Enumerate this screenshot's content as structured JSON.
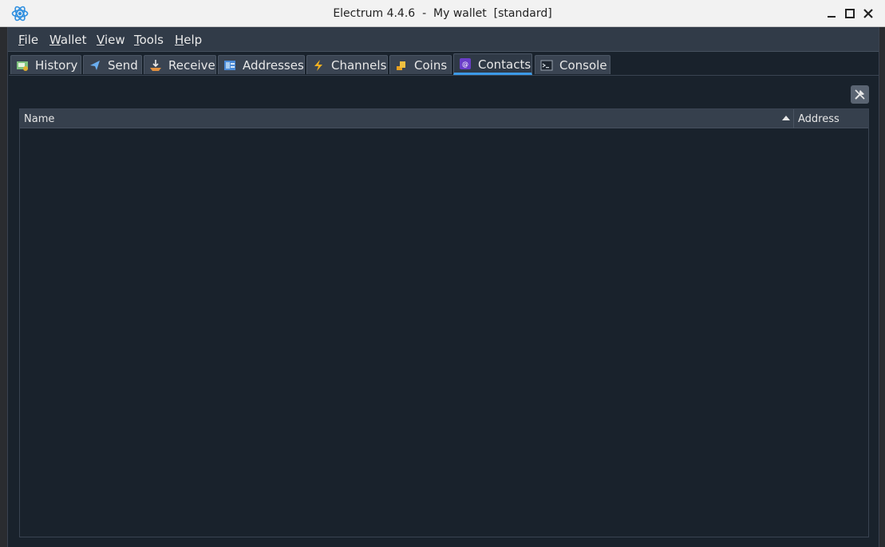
{
  "window": {
    "title": "Electrum 4.4.6  -  My wallet  [standard]"
  },
  "menu": [
    {
      "underline": "F",
      "rest": "ile"
    },
    {
      "underline": "W",
      "rest": "allet"
    },
    {
      "underline": "V",
      "rest": "iew"
    },
    {
      "underline": "T",
      "rest": "ools"
    },
    {
      "underline": "H",
      "rest": "elp"
    }
  ],
  "tabs": [
    {
      "label": "History",
      "icon": "history-icon",
      "active": false
    },
    {
      "label": "Send",
      "icon": "send-icon",
      "active": false
    },
    {
      "label": "Receive",
      "icon": "receive-icon",
      "active": false
    },
    {
      "label": "Addresses",
      "icon": "addresses-icon",
      "active": false
    },
    {
      "label": "Channels",
      "icon": "lightning-icon",
      "active": false
    },
    {
      "label": "Coins",
      "icon": "coins-icon",
      "active": false
    },
    {
      "label": "Contacts",
      "icon": "contacts-icon",
      "active": true
    },
    {
      "label": "Console",
      "icon": "console-icon",
      "active": false
    }
  ],
  "contacts": {
    "columns": [
      "Name",
      "Address"
    ],
    "rows": []
  },
  "colors": {
    "accent": "#3c9ae8",
    "background": "#19222c",
    "menubar": "#313b48"
  }
}
